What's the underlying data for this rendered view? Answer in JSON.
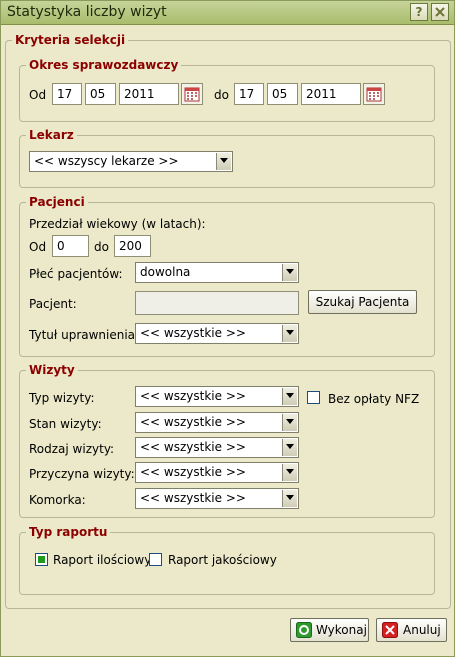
{
  "window": {
    "title": "Statystyka liczby wizyt"
  },
  "criteria": {
    "legend": "Kryteria selekcji",
    "period": {
      "legend": "Okres sprawozdawczy",
      "from_label": "Od",
      "from_day": "17",
      "from_month": "05",
      "from_year": "2011",
      "to_label": "do",
      "to_day": "17",
      "to_month": "05",
      "to_year": "2011"
    },
    "doctor": {
      "legend": "Lekarz",
      "selected": "<< wszyscy lekarze >>"
    },
    "patients": {
      "legend": "Pacjenci",
      "age_range_label": "Przedział wiekowy (w latach):",
      "from_label": "Od",
      "from_value": "0",
      "to_label": "do",
      "to_value": "200",
      "gender_label": "Płeć pacjentów:",
      "gender_selected": "dowolna",
      "patient_label": "Pacjent:",
      "patient_value": "",
      "search_button": "Szukaj Pacjenta",
      "entitlement_label": "Tytuł uprawnienia:",
      "entitlement_selected": "<< wszystkie >>"
    },
    "visits": {
      "legend": "Wizyty",
      "type_label": "Typ wizyty:",
      "type_selected": "<< wszystkie >>",
      "no_fee_label": "Bez opłaty NFZ",
      "no_fee_checked": false,
      "state_label": "Stan wizyty:",
      "state_selected": "<< wszystkie >>",
      "kind_label": "Rodzaj wizyty:",
      "kind_selected": "<< wszystkie >>",
      "reason_label": "Przyczyna wizyty:",
      "reason_selected": "<< wszystkie >>",
      "cell_label": "Komorka:",
      "cell_selected": "<< wszystkie >>"
    },
    "report_type": {
      "legend": "Typ raportu",
      "quantitative_label": "Raport ilościowy",
      "quantitative_checked": true,
      "qualitative_label": "Raport jakościowy",
      "qualitative_checked": false
    }
  },
  "footer": {
    "execute_button": "Wykonaj",
    "cancel_button": "Anuluj"
  },
  "icons": {
    "help": "help-icon",
    "close": "close-icon",
    "calendar": "calendar-icon",
    "execute": "execute-icon",
    "cancel": "cancel-icon"
  },
  "colors": {
    "legend": "#8b0000",
    "titlebar": "#b5c67e",
    "panel": "#ebe9c9"
  }
}
